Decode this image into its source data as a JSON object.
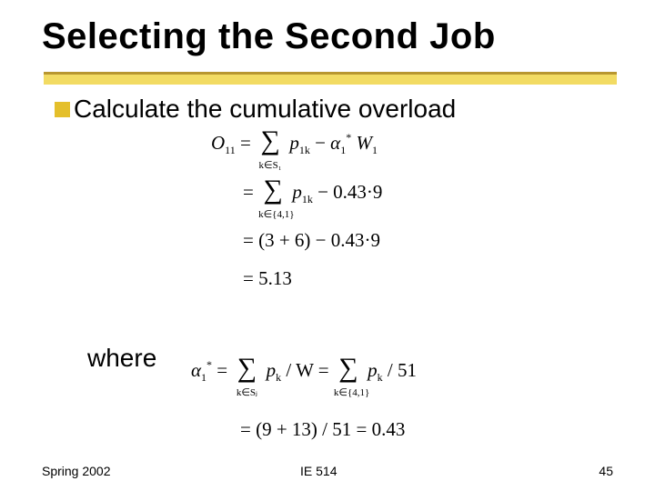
{
  "title": "Selecting the Second Job",
  "bullet": "Calculate the cumulative overload",
  "where": "where",
  "foot_left": "Spring 2002",
  "foot_mid": "IE 514",
  "foot_right": "45",
  "eq1": {
    "lhs_var": "O",
    "lhs_sub": "11",
    "sum_bot": "k∈S₁",
    "term": "p",
    "term_sub": "1k",
    "minus": "−",
    "a": "α",
    "a_sub": "1",
    "a_sup": "*",
    "W": "W",
    "W_sub": "1"
  },
  "eq2": {
    "eq": "=",
    "sum_bot": "k∈{4,1}",
    "term": "p",
    "term_sub": "1k",
    "rhs": "− 0.43·9"
  },
  "eq3": {
    "text": "= (3 + 6) − 0.43·9"
  },
  "eq4": {
    "text": "= 5.13"
  },
  "eq5": {
    "a": "α",
    "a_sub": "1",
    "a_sup": "*",
    "eq": " = ",
    "sum1_bot": "k∈Sⱼ",
    "p": "p",
    "p_sub": "k",
    "overW": " / W  =  ",
    "sum2_bot": "k∈{4,1}",
    "p2": "p",
    "p2_sub": "k",
    "over51": " / 51"
  },
  "eq6": {
    "text": "= (9 + 13) / 51 = 0.43"
  }
}
